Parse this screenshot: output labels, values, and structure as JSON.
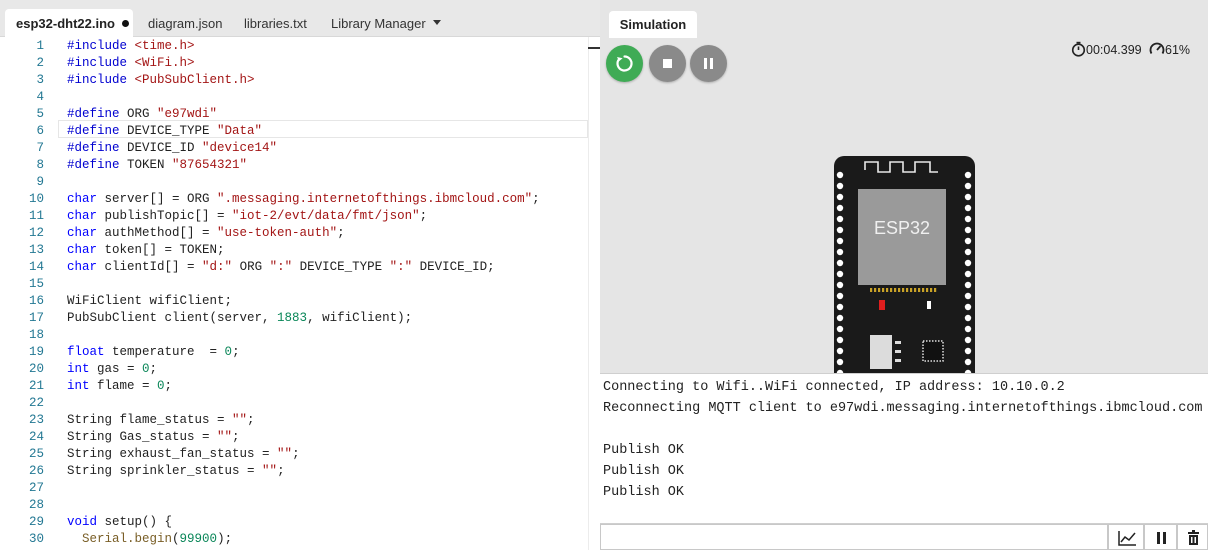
{
  "tabs": {
    "ino": "esp32-dht22.ino",
    "diagram": "diagram.json",
    "libraries": "libraries.txt",
    "library_manager": "Library Manager"
  },
  "code": [
    {
      "n": "1",
      "t": "#include <time.h>"
    },
    {
      "n": "2",
      "t": "#include <WiFi.h>"
    },
    {
      "n": "3",
      "t": "#include <PubSubClient.h>"
    },
    {
      "n": "4",
      "t": ""
    },
    {
      "n": "5",
      "t": "#define ORG \"e97wdi\""
    },
    {
      "n": "6",
      "t": "#define DEVICE_TYPE \"Data\""
    },
    {
      "n": "7",
      "t": "#define DEVICE_ID \"device14\""
    },
    {
      "n": "8",
      "t": "#define TOKEN \"87654321\""
    },
    {
      "n": "9",
      "t": ""
    },
    {
      "n": "10",
      "t": "char server[] = ORG \".messaging.internetofthings.ibmcloud.com\";"
    },
    {
      "n": "11",
      "t": "char publishTopic[] = \"iot-2/evt/data/fmt/json\";"
    },
    {
      "n": "12",
      "t": "char authMethod[] = \"use-token-auth\";"
    },
    {
      "n": "13",
      "t": "char token[] = TOKEN;"
    },
    {
      "n": "14",
      "t": "char clientId[] = \"d:\" ORG \":\" DEVICE_TYPE \":\" DEVICE_ID;"
    },
    {
      "n": "15",
      "t": ""
    },
    {
      "n": "16",
      "t": "WiFiClient wifiClient;"
    },
    {
      "n": "17",
      "t": "PubSubClient client(server, 1883, wifiClient);"
    },
    {
      "n": "18",
      "t": ""
    },
    {
      "n": "19",
      "t": "float temperature  = 0;"
    },
    {
      "n": "20",
      "t": "int gas = 0;"
    },
    {
      "n": "21",
      "t": "int flame = 0;"
    },
    {
      "n": "22",
      "t": ""
    },
    {
      "n": "23",
      "t": "String flame_status = \"\";"
    },
    {
      "n": "24",
      "t": "String Gas_status = \"\";"
    },
    {
      "n": "25",
      "t": "String exhaust_fan_status = \"\";"
    },
    {
      "n": "26",
      "t": "String sprinkler_status = \"\";"
    },
    {
      "n": "27",
      "t": ""
    },
    {
      "n": "28",
      "t": ""
    },
    {
      "n": "29",
      "t": "void setup() {"
    },
    {
      "n": "30",
      "t": "  Serial.begin(99900);"
    }
  ],
  "simulation": {
    "tab_label": "Simulation",
    "timer": "00:04.399",
    "speed": "61%",
    "board_label": "ESP32"
  },
  "serial": {
    "lines": [
      "Connecting to Wifi..WiFi connected, IP address: 10.10.0.2",
      "Reconnecting MQTT client to e97wdi.messaging.internetofthings.ibmcloud.com",
      "",
      "Publish OK",
      "Publish OK",
      "Publish OK"
    ],
    "input_value": ""
  },
  "colors": {
    "restart_green": "#3fab55",
    "control_gray": "#8a8a8a",
    "board_black": "#1a1a1a",
    "chip_gray": "#9a9a9a"
  }
}
